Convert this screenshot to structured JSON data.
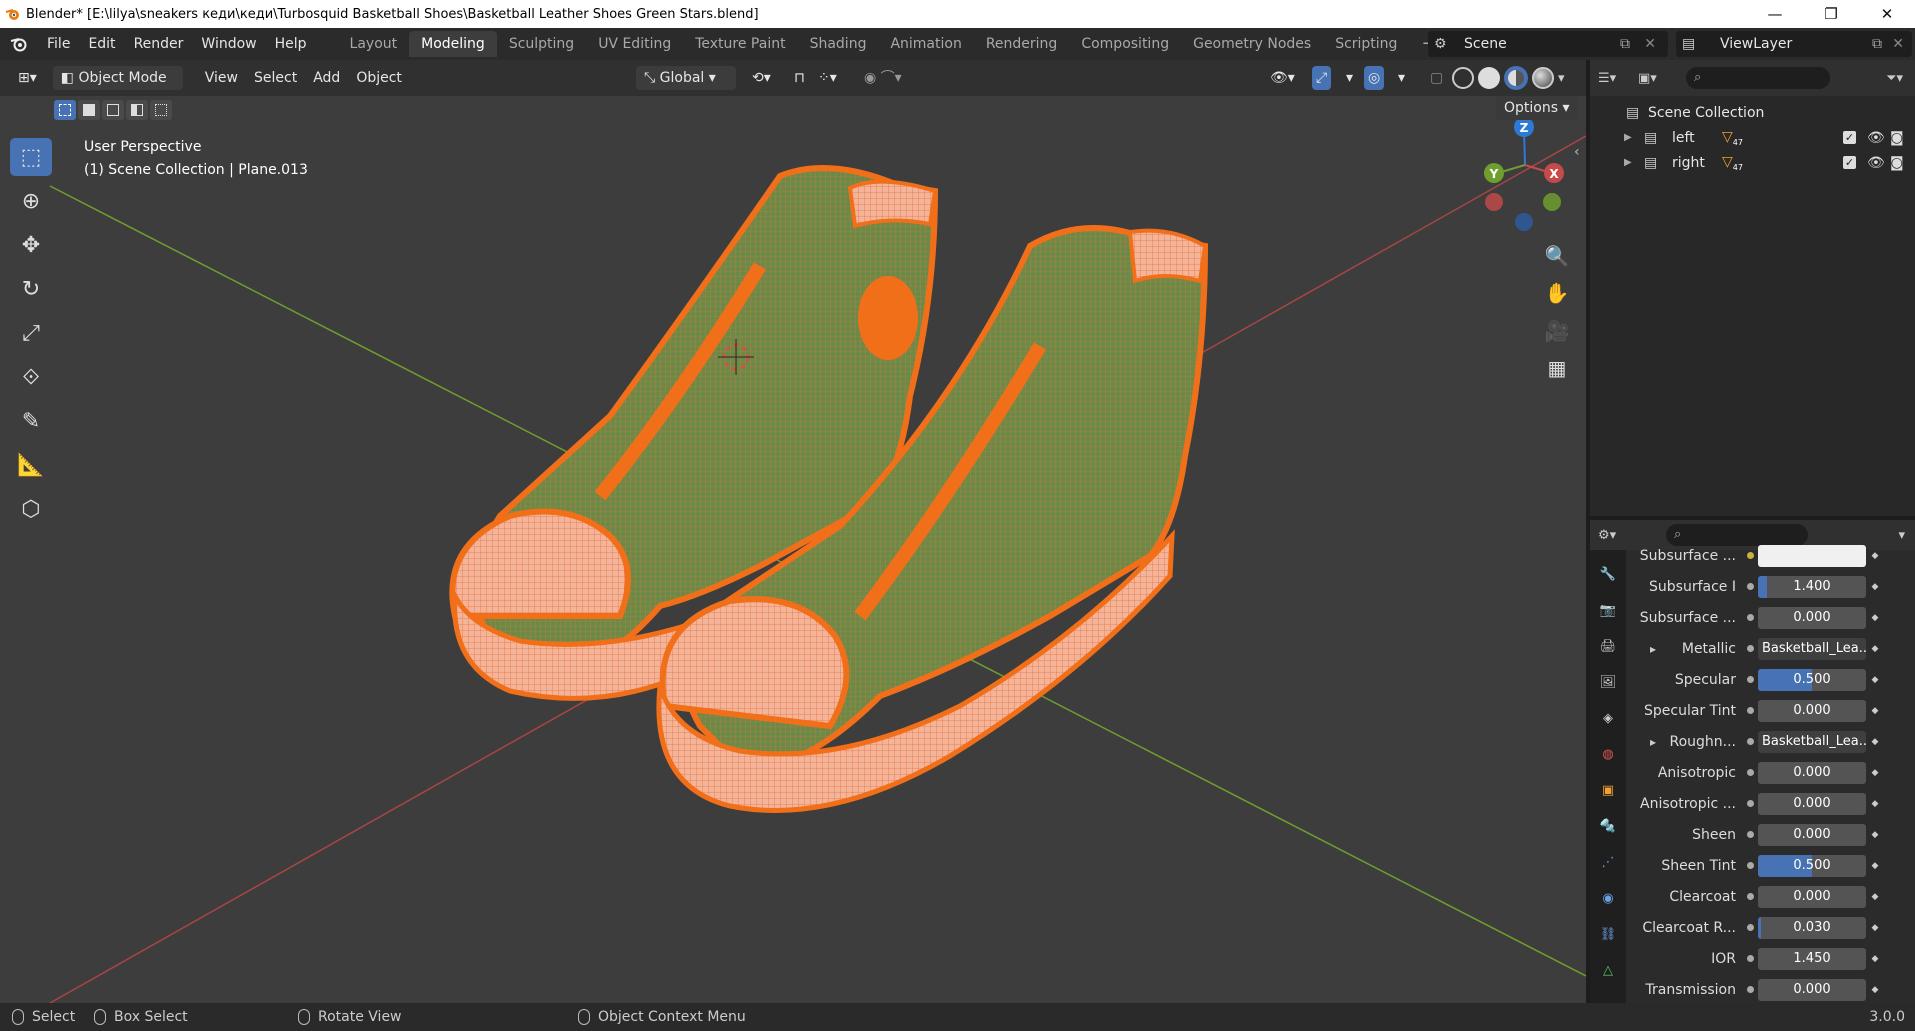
{
  "window": {
    "title": "Blender* [E:\\lilya\\sneakers кеди\\кеди\\Turbosquid Basketball Shoes\\Basketball Leather Shoes Green Stars.blend]",
    "minimize": "—",
    "maximize": "❐",
    "close": "✕"
  },
  "menu": [
    "File",
    "Edit",
    "Render",
    "Window",
    "Help"
  ],
  "workspaces": [
    "Layout",
    "Modeling",
    "Sculpting",
    "UV Editing",
    "Texture Paint",
    "Shading",
    "Animation",
    "Rendering",
    "Compositing",
    "Geometry Nodes",
    "Scripting",
    "+"
  ],
  "active_workspace": "Modeling",
  "scene_name": "Scene",
  "view_layer": "ViewLayer",
  "viewport_header": {
    "mode": "Object Mode",
    "menus": [
      "View",
      "Select",
      "Add",
      "Object"
    ],
    "orientation": "Global"
  },
  "viewport": {
    "options": "Options",
    "perspective": "User Perspective",
    "collection_info": "(1) Scene Collection | Plane.013",
    "gizmo": {
      "x": "X",
      "y": "Y",
      "z": "Z"
    }
  },
  "outliner": {
    "root": "Scene Collection",
    "items": [
      {
        "name": "left",
        "badge": "47"
      },
      {
        "name": "right",
        "badge": "47"
      }
    ]
  },
  "properties": [
    {
      "label": "Subsurface ...",
      "value": "",
      "type": "color"
    },
    {
      "label": "Subsurface I",
      "value": "1.400",
      "fill": 0.08
    },
    {
      "label": "Subsurface ...",
      "value": "0.000",
      "fill": 0
    },
    {
      "label": "Metallic",
      "value": "Basketball_Lea...",
      "type": "link",
      "expand": "▸"
    },
    {
      "label": "Specular",
      "value": "0.500",
      "fill": 0.5
    },
    {
      "label": "Specular Tint",
      "value": "0.000",
      "fill": 0
    },
    {
      "label": "Roughn...",
      "value": "Basketball_Lea...",
      "type": "link",
      "expand": "▸"
    },
    {
      "label": "Anisotropic",
      "value": "0.000",
      "fill": 0
    },
    {
      "label": "Anisotropic ...",
      "value": "0.000",
      "fill": 0
    },
    {
      "label": "Sheen",
      "value": "0.000",
      "fill": 0
    },
    {
      "label": "Sheen Tint",
      "value": "0.500",
      "fill": 0.5
    },
    {
      "label": "Clearcoat",
      "value": "0.000",
      "fill": 0
    },
    {
      "label": "Clearcoat R...",
      "value": "0.030",
      "fill": 0.03
    },
    {
      "label": "IOR",
      "value": "1.450",
      "fill": 0
    },
    {
      "label": "Transmission",
      "value": "0.000",
      "fill": 0
    }
  ],
  "status": {
    "select": "Select",
    "box_select": "Box Select",
    "rotate_view": "Rotate View",
    "context_menu": "Object Context Menu",
    "version": "3.0.0"
  },
  "colors": {
    "selection_orange": "#f26f1a",
    "upper_green": "#6d8a4a",
    "accent_blue": "#4772b3",
    "axis_x": "#c74a4a",
    "axis_y": "#6f9e2f"
  }
}
